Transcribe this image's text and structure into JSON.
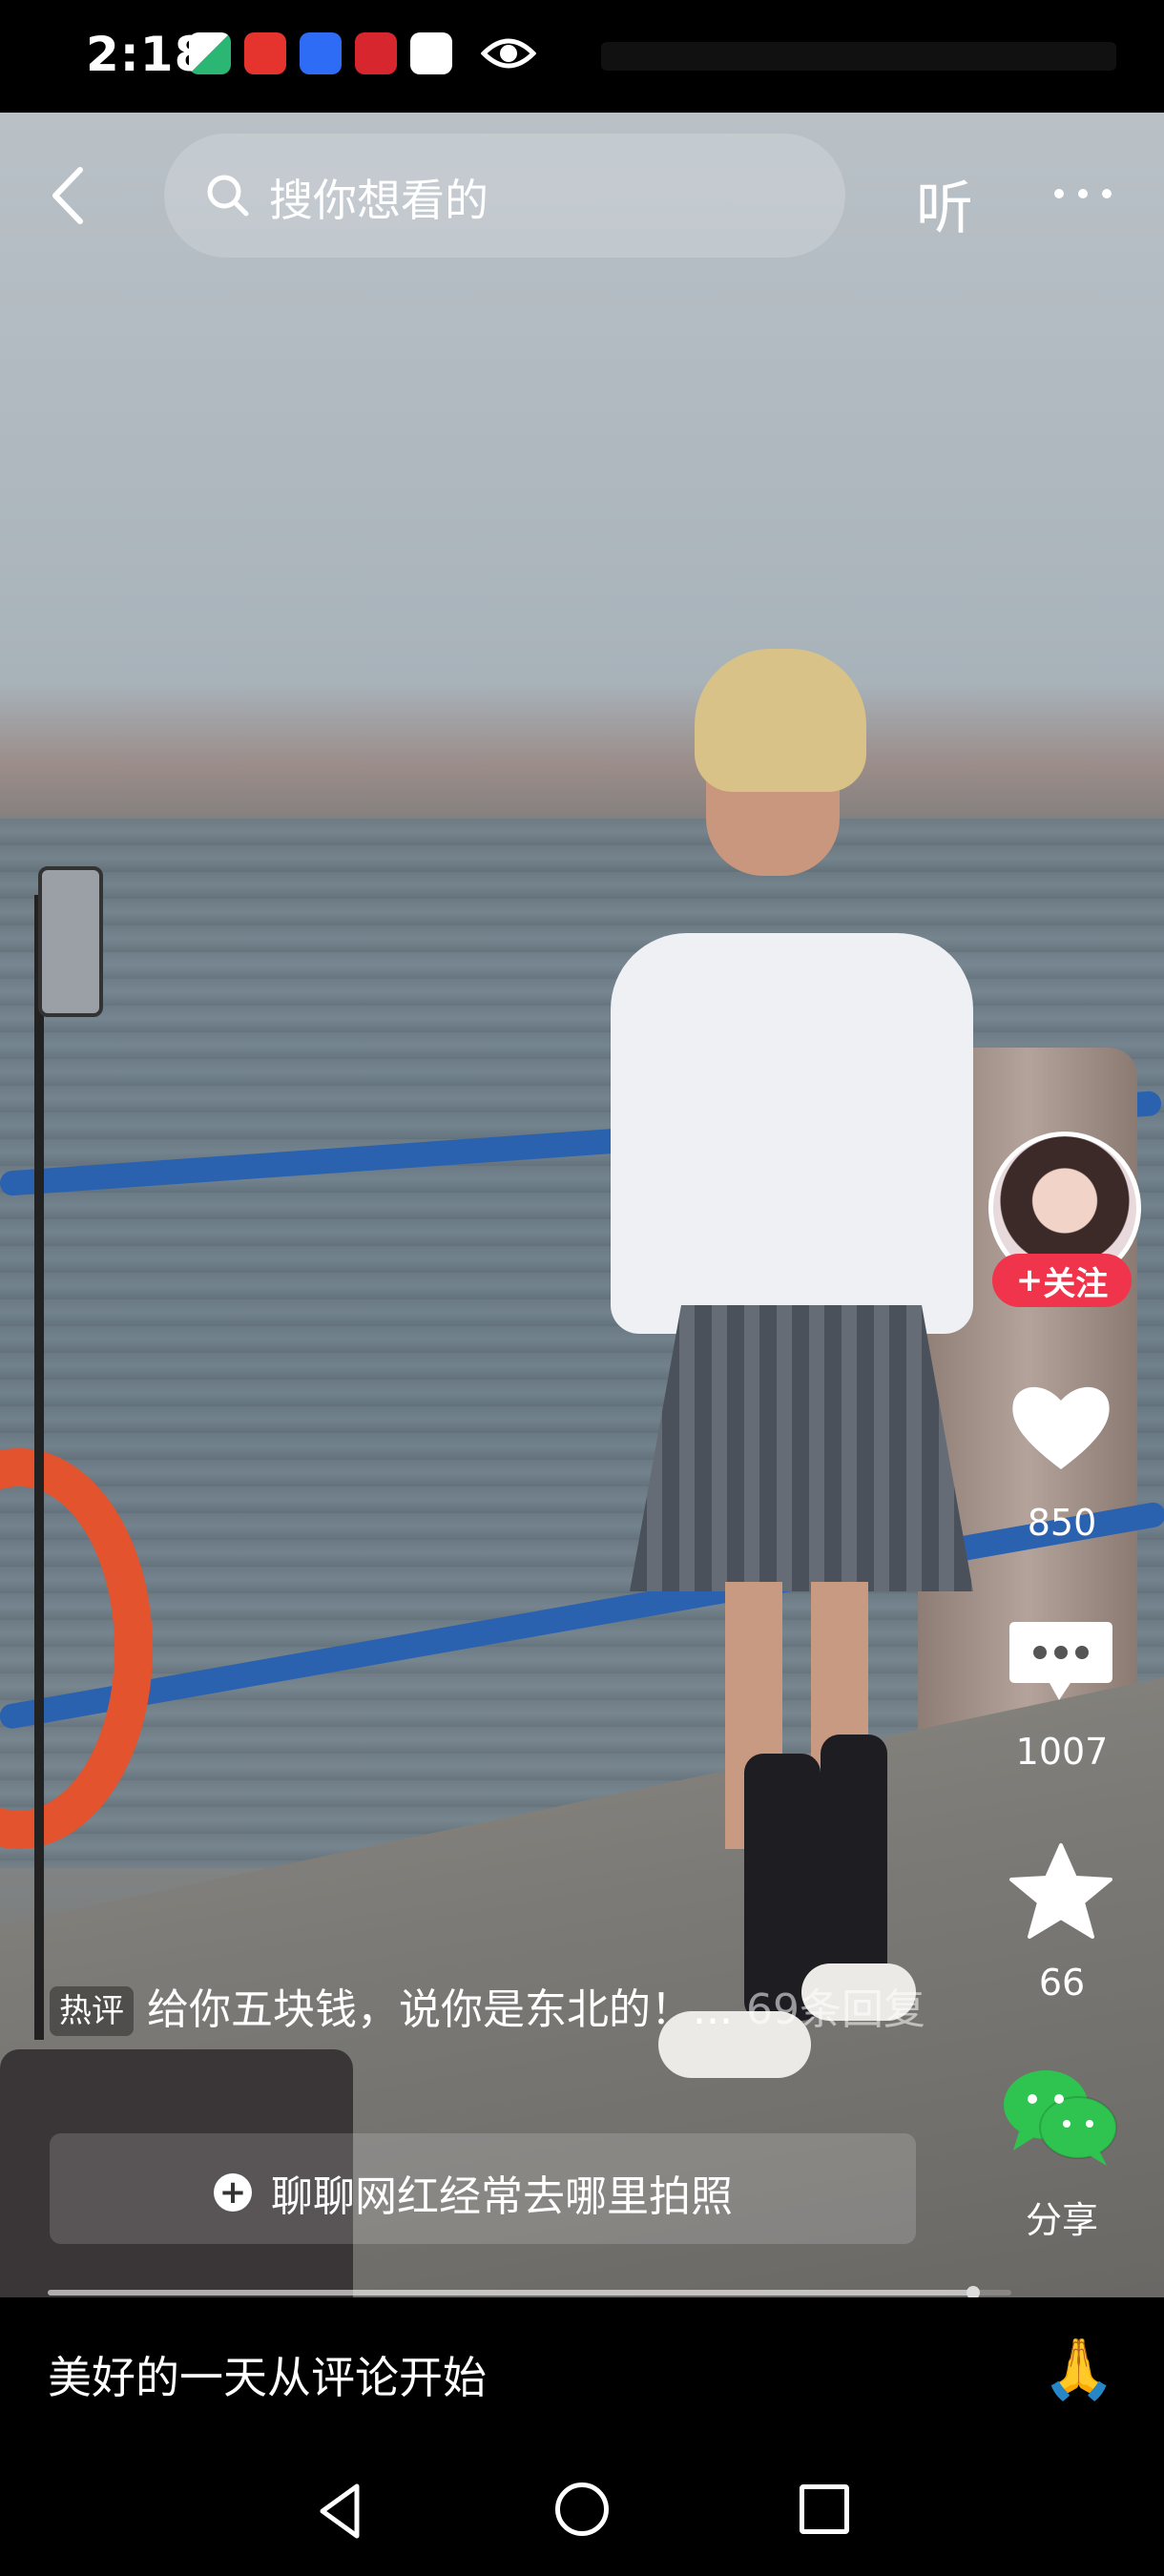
{
  "status_bar": {
    "time": "2:18"
  },
  "top_bar": {
    "search_placeholder": "搜你想看的",
    "listen_label": "听"
  },
  "actions": {
    "follow_label": "关注",
    "like_count": "850",
    "comment_count": "1007",
    "favorite_count": "66",
    "share_label": "分享"
  },
  "hot_comment": {
    "tag": "热评",
    "text": "给你五块钱，说你是东北的！...",
    "replies": "69条回复"
  },
  "chat_chip": {
    "label": "聊聊网红经常去哪里拍照"
  },
  "progress": {
    "value": 0.96
  },
  "comment_bar": {
    "placeholder": "美好的一天从评论开始",
    "emojis": [
      "😂",
      "😆",
      "🙏"
    ]
  },
  "colors": {
    "follow": "#f0344b",
    "wechat": "#2fc34f",
    "rail": "#2a62b0"
  }
}
